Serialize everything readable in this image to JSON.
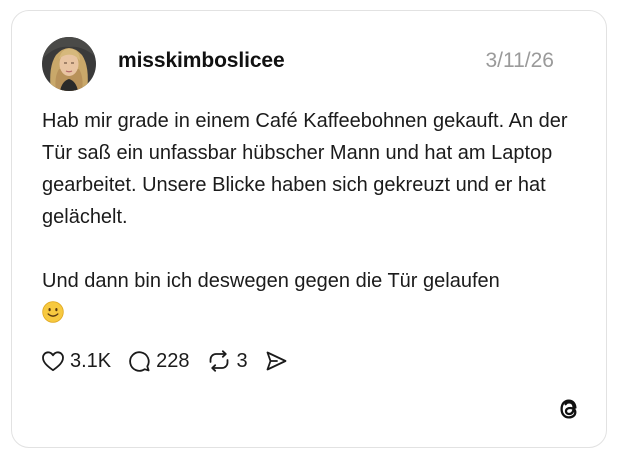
{
  "post": {
    "username": "misskimboslicee",
    "date": "3/11/26",
    "paragraphs": [
      "Hab mir grade in einem Café Kaffeebohnen gekauft. An der Tür saß ein unfassbar hübscher Mann und hat am Laptop gearbeitet. Unsere Blicke haben sich gekreuzt und er hat gelächelt.",
      "Und dann bin ich deswegen gegen die Tür gelaufen"
    ],
    "emoji_icon": "slightly-smiling-face"
  },
  "actions": {
    "likes": "3.1K",
    "replies": "228",
    "reposts": "3",
    "icons": [
      "heart-icon",
      "reply-bubble-icon",
      "repost-icon",
      "share-icon"
    ]
  },
  "brand": {
    "icon": "threads-logo",
    "accent": "#111111",
    "muted": "#9a9a9a"
  }
}
